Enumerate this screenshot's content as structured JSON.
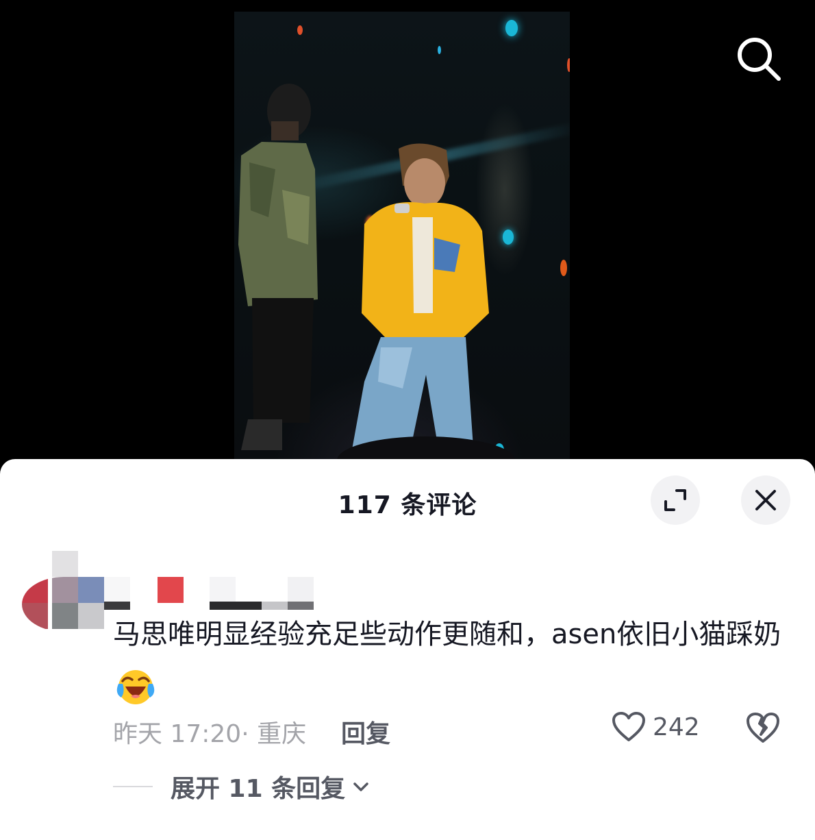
{
  "video": {
    "search_icon": "search-icon"
  },
  "sheet": {
    "title": "117 条评论",
    "expand_icon": "expand-icon",
    "close_icon": "close-icon"
  },
  "comment": {
    "text": "马思唯明显经验充足些动作更随和，asen依旧小猫踩奶",
    "emoji": "laughing-crying-emoji",
    "time": "昨天 17:20",
    "separator": "·",
    "location": "重庆",
    "reply_label": "回复",
    "like_count": "242",
    "like_icon": "heart-icon",
    "dislike_icon": "broken-heart-icon",
    "expand_replies_label": "展开 11 条回复",
    "expand_chevron_icon": "chevron-down-icon"
  },
  "colors": {
    "sheet_bg": "#ffffff",
    "title_text": "#161823",
    "meta_text": "#a3a4a9",
    "action_text": "#555862"
  }
}
